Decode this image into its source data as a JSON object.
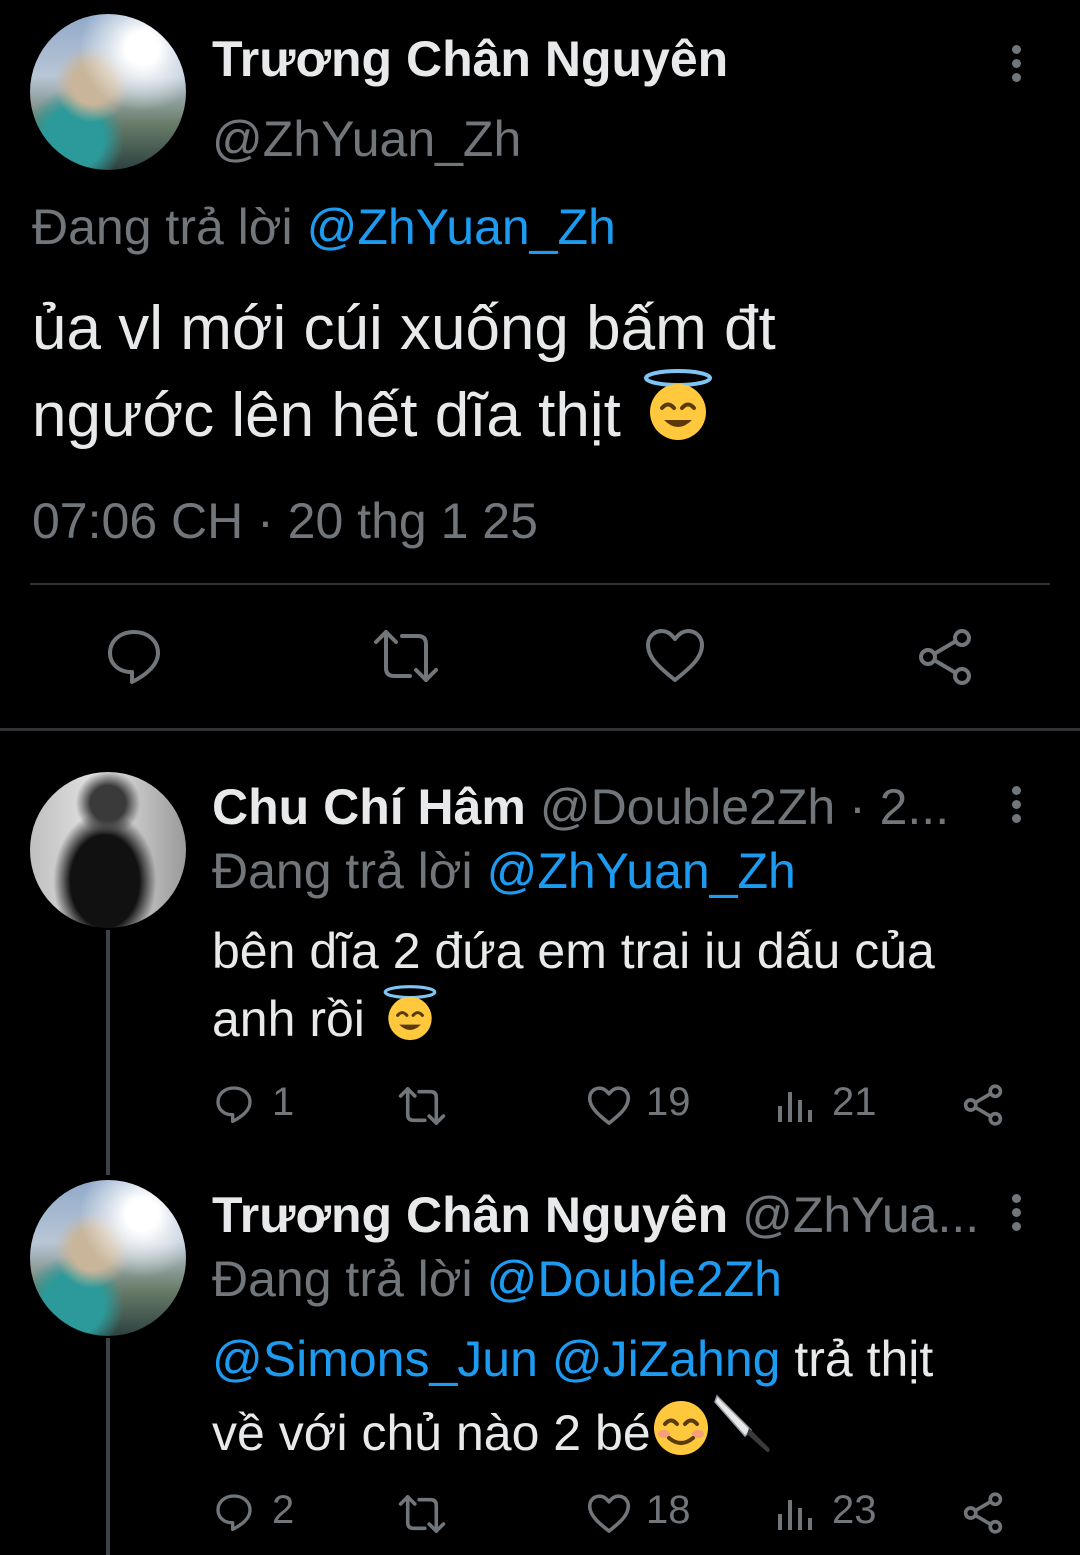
{
  "main_tweet": {
    "author_name": "Trương Chân Nguyên",
    "handle": "@ZhYuan_Zh",
    "replying_prefix": "Đang trả lời",
    "replying_to": "@ZhYuan_Zh",
    "text_line1": "ủa vl mới cúi xuống bấm đt",
    "text_line2": "ngước lên hết dĩa thịt",
    "timestamp": "07:06 CH · 20 thg 1 25",
    "emoji": "smiling-face-with-halo"
  },
  "reply1": {
    "author_name": "Chu Chí Hâm",
    "handle_time": "@Double2Zh · 2...",
    "replying_prefix": "Đang trả lời",
    "replying_to": "@ZhYuan_Zh",
    "text_line1": "bên dĩa 2 đứa em trai iu dấu của",
    "text_line2": "anh rồi",
    "emoji": "smiling-face-with-halo",
    "replies": "1",
    "likes": "19",
    "views": "21"
  },
  "reply2": {
    "author_name": "Trương Chân Nguyên",
    "handle_time": "@ZhYua...",
    "replying_prefix": "Đang trả lời",
    "replying_to": "@Double2Zh",
    "mention1": "@Simons_Jun",
    "mention2": "@JiZahng",
    "text_tail": "trả thịt",
    "text_line2": "về với chủ nào 2 bé",
    "emojis": [
      "smiling-face",
      "kitchen-knife"
    ],
    "replies": "2",
    "likes": "18",
    "views": "23"
  },
  "colors": {
    "background": "#000000",
    "text": "#e7e9ea",
    "muted": "#71767b",
    "link": "#1d9bf0",
    "divider": "#2f3336"
  }
}
